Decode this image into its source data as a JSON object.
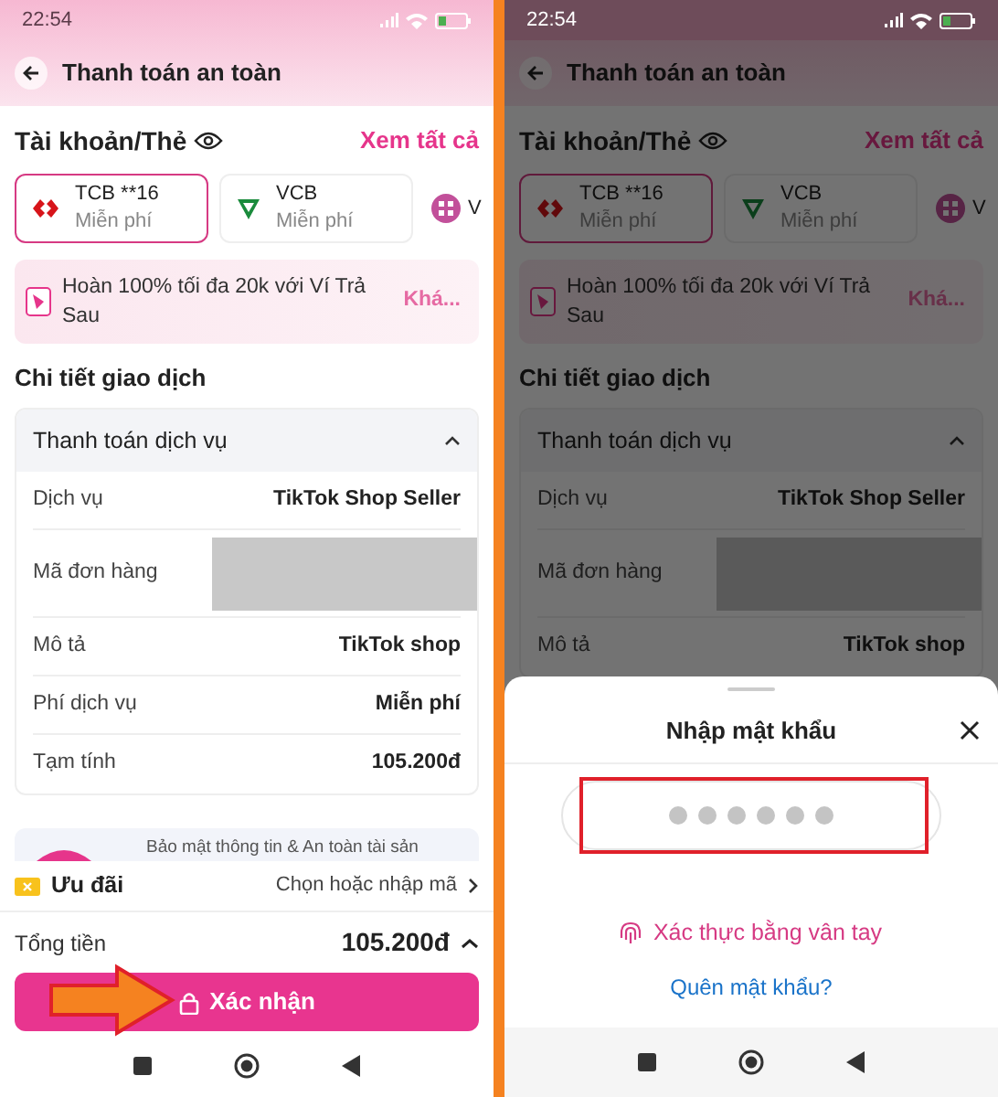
{
  "left_screen": {
    "status_bar": {
      "time": "22:54"
    },
    "header": {
      "title": "Thanh toán an toàn"
    },
    "accounts": {
      "title": "Tài khoản/Thẻ",
      "see_all": "Xem tất cả",
      "cards": [
        {
          "kind": "tcb",
          "name": "TCB **16",
          "fee": "Miễn phí",
          "selected": true
        },
        {
          "kind": "vcb",
          "name": "VCB",
          "fee": "Miễn phí",
          "selected": false
        },
        {
          "kind": "momo",
          "name": "V",
          "selected": false
        }
      ]
    },
    "promo": {
      "text": "Hoàn 100% tối đa 20k với Ví Trả Sau",
      "action": "Khá..."
    },
    "details": {
      "title": "Chi tiết giao dịch",
      "section": {
        "title": "Thanh toán dịch vụ",
        "expanded": true,
        "rows": [
          {
            "kind": "text",
            "label": "Dịch vụ",
            "value": "TikTok Shop Seller"
          },
          {
            "kind": "redacted",
            "label": "Mã đơn hàng"
          },
          {
            "kind": "text",
            "label": "Mô tả",
            "value": "TikTok shop"
          },
          {
            "kind": "text",
            "label": "Phí dịch vụ",
            "value": "Miễn phí"
          },
          {
            "kind": "text",
            "label": "Tạm tính",
            "value": "105.200đ"
          }
        ]
      }
    },
    "banner": {
      "text": "Bảo mật thông tin & An toàn tài sản"
    },
    "offer": {
      "label": "Ưu đãi",
      "action": "Chọn hoặc nhập mã"
    },
    "total": {
      "label": "Tổng tiền",
      "amount": "105.200đ"
    },
    "confirm_button": "Xác nhận"
  },
  "right_screen": {
    "status_bar": {
      "time": "22:54"
    },
    "header": {
      "title": "Thanh toán an toàn"
    },
    "accounts": {
      "title": "Tài khoản/Thẻ",
      "see_all": "Xem tất cả",
      "cards": [
        {
          "kind": "tcb",
          "name": "TCB **16",
          "fee": "Miễn phí",
          "selected": true
        },
        {
          "kind": "vcb",
          "name": "VCB",
          "fee": "Miễn phí",
          "selected": false
        },
        {
          "kind": "momo",
          "name": "V",
          "selected": false
        }
      ]
    },
    "promo": {
      "text": "Hoàn 100% tối đa 20k với Ví Trả Sau",
      "action": "Khá..."
    },
    "details": {
      "title": "Chi tiết giao dịch",
      "section": {
        "title": "Thanh toán dịch vụ",
        "expanded": true,
        "rows": [
          {
            "kind": "text",
            "label": "Dịch vụ",
            "value": "TikTok Shop Seller"
          },
          {
            "kind": "redacted",
            "label": "Mã đơn hàng"
          },
          {
            "kind": "text",
            "label": "Mô tả",
            "value": "TikTok shop"
          }
        ]
      }
    }
  },
  "password_sheet": {
    "title": "Nhập mật khẩu",
    "pin_dots": [
      {
        "filled": false
      },
      {
        "filled": false
      },
      {
        "filled": false
      },
      {
        "filled": false
      },
      {
        "filled": false
      },
      {
        "filled": false
      }
    ],
    "fingerprint_link": "Xác thực bằng vân tay",
    "forgot_link": "Quên mật khẩu?"
  }
}
